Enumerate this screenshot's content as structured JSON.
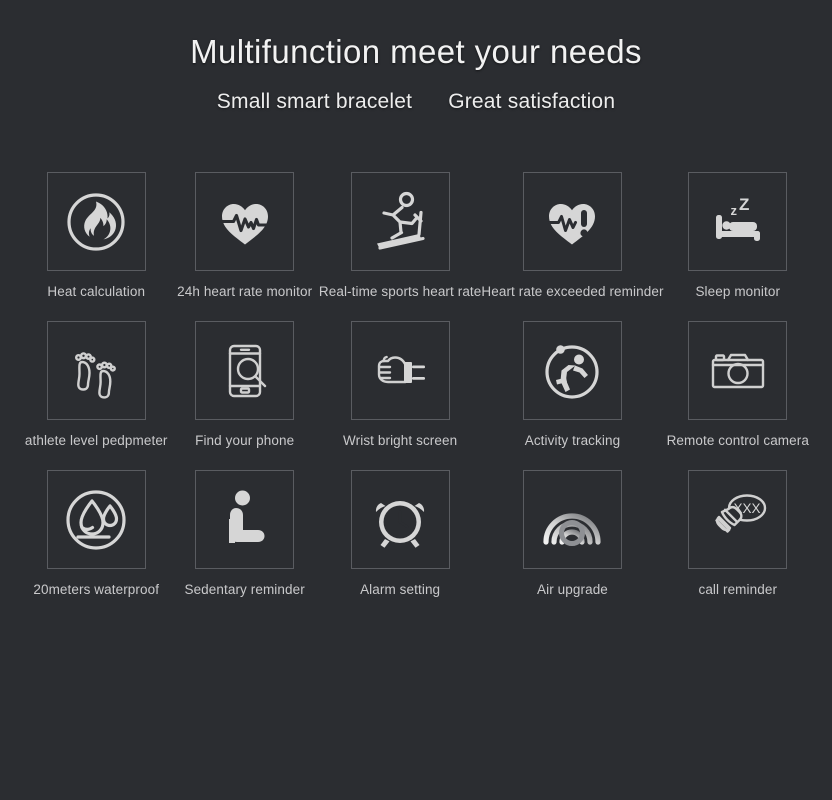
{
  "header": {
    "title": "Multifunction meet your needs",
    "subtitle_left": "Small smart bracelet",
    "subtitle_right": "Great satisfaction"
  },
  "theme": {
    "background": "#2b2d31",
    "tile_border": "#5a5c61",
    "icon_color": "#d6d6d6",
    "title_color": "#f2f2f2",
    "label_color": "#c9c9cb"
  },
  "features": [
    {
      "icon": "flame-in-circle-icon",
      "label": "Heat calculation"
    },
    {
      "icon": "heart-pulse-icon",
      "label": "24h heart rate monitor"
    },
    {
      "icon": "treadmill-runner-icon",
      "label": "Real-time sports heart rate"
    },
    {
      "icon": "heart-alert-icon",
      "label": "Heart rate exceeded reminder"
    },
    {
      "icon": "bed-sleep-icon",
      "label": "Sleep monitor"
    },
    {
      "icon": "footprints-icon",
      "label": "athlete level pedpmeter"
    },
    {
      "icon": "phone-search-icon",
      "label": "Find your phone"
    },
    {
      "icon": "wrist-fist-icon",
      "label": "Wrist bright screen"
    },
    {
      "icon": "runner-in-circle-icon",
      "label": "Activity tracking"
    },
    {
      "icon": "camera-icon",
      "label": "Remote control camera"
    },
    {
      "icon": "water-drops-circle-icon",
      "label": "20meters waterproof"
    },
    {
      "icon": "sitting-person-icon",
      "label": "Sedentary reminder"
    },
    {
      "icon": "alarm-clock-icon",
      "label": "Alarm setting"
    },
    {
      "icon": "signal-arcs-icon",
      "label": "Air upgrade"
    },
    {
      "icon": "phone-bubble-icon",
      "label": "call reminder"
    }
  ],
  "icon_text": {
    "sleep_z_small": "z",
    "sleep_z_large": "Z",
    "call_bubble_text": "XXX"
  }
}
